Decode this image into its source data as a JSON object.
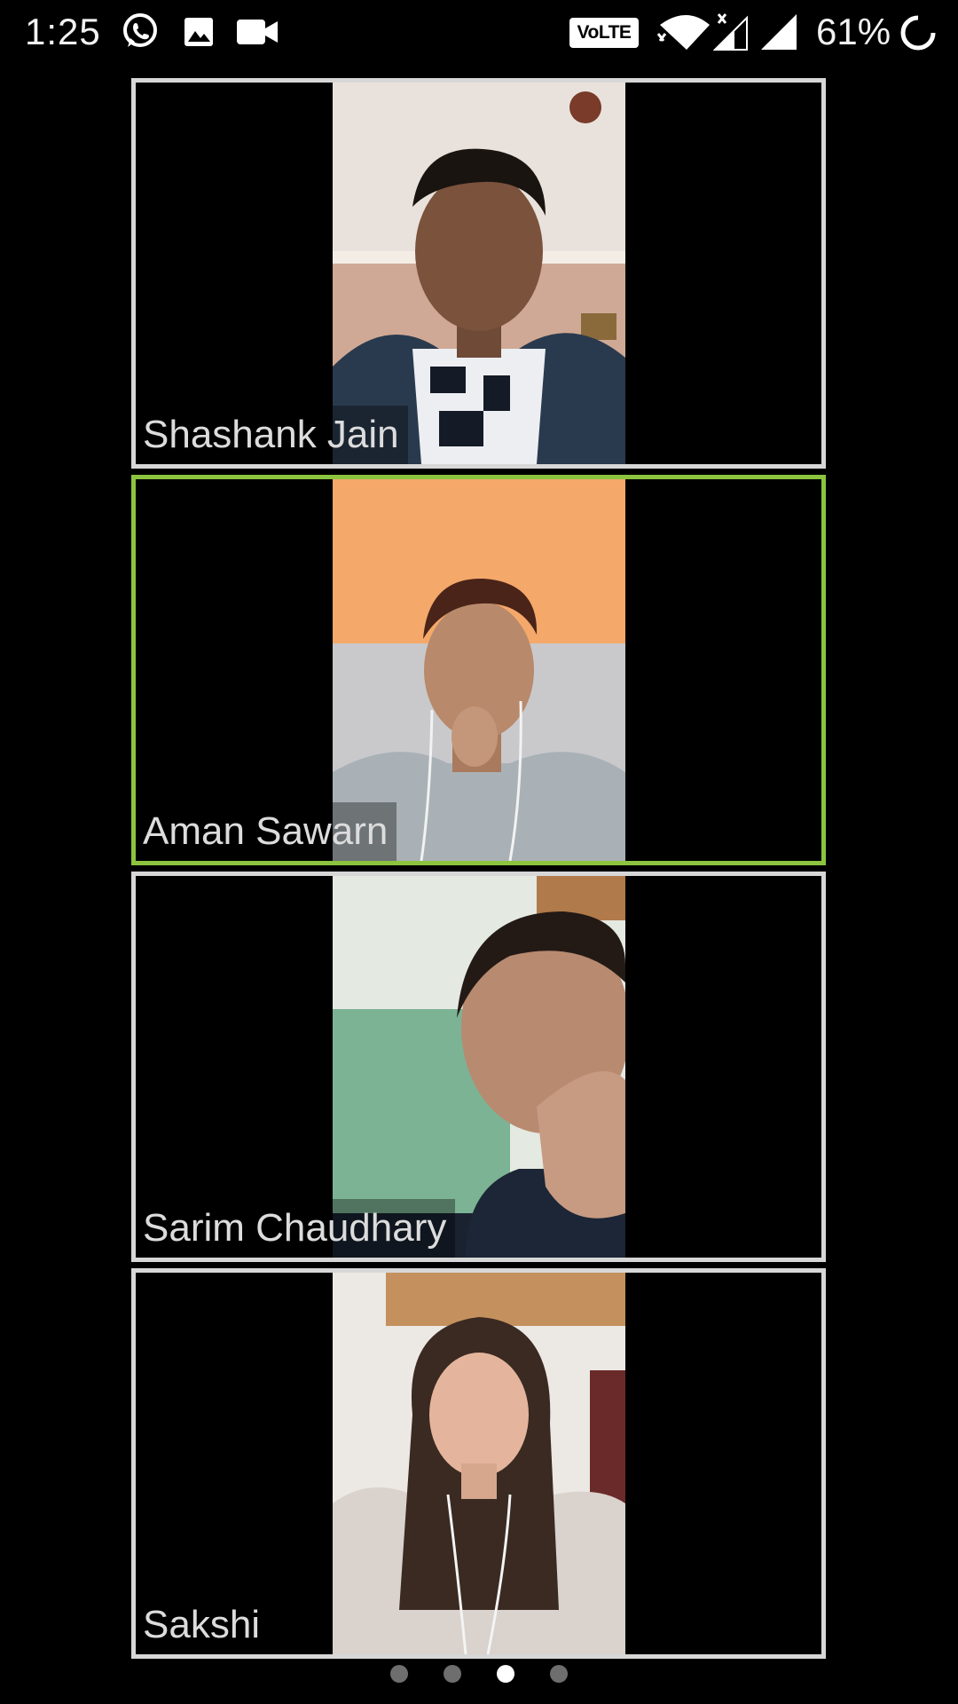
{
  "status_bar": {
    "time": "1:25",
    "network_badge": "VoLTE",
    "battery_percent": "61%",
    "icons": [
      "whatsapp-icon",
      "gallery-icon",
      "video-camera-icon",
      "wifi-icon",
      "signal-icon",
      "signal-icon",
      "battery-saver-icon"
    ]
  },
  "participants": [
    {
      "name": "Shashank Jain",
      "active_speaker": false
    },
    {
      "name": "Aman Sawarn",
      "active_speaker": true
    },
    {
      "name": "Sarim Chaudhary",
      "active_speaker": false
    },
    {
      "name": "Sakshi",
      "active_speaker": false
    }
  ],
  "pager": {
    "total_pages": 4,
    "current_page": 3
  },
  "colors": {
    "active_speaker_border": "#8cc43f",
    "tile_border": "#d7d7d7",
    "background": "#000000"
  }
}
